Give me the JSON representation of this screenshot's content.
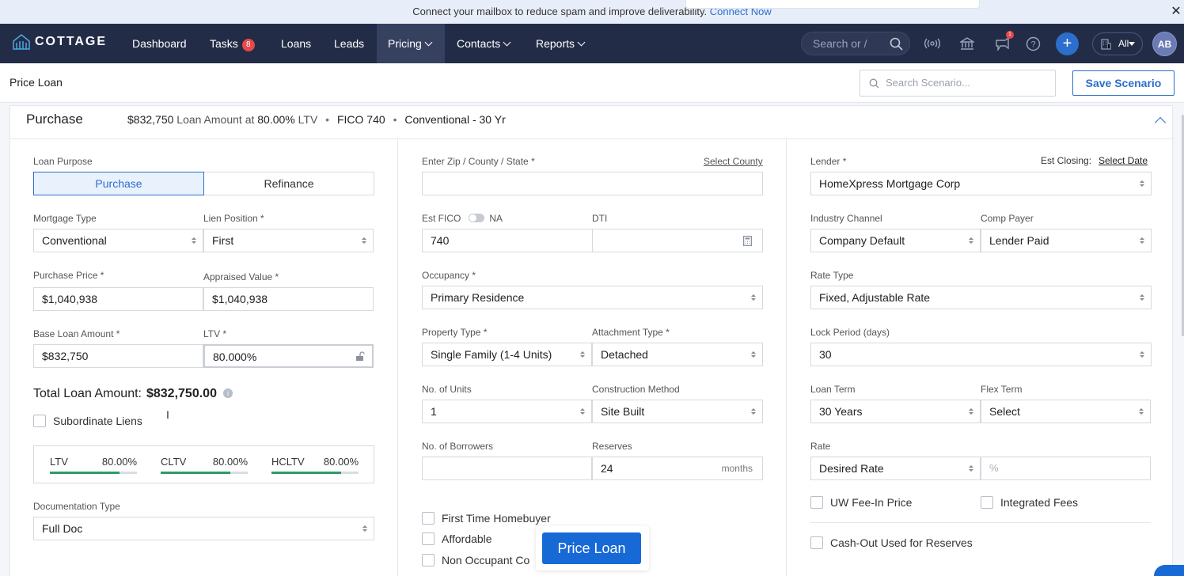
{
  "banner": {
    "text": "Connect your mailbox to reduce spam and improve deliverability.",
    "link": "Connect Now",
    "close": "✕"
  },
  "nav": {
    "logo": "COTTAGE",
    "items": [
      {
        "label": "Dashboard"
      },
      {
        "label": "Tasks",
        "badge": "8"
      },
      {
        "label": "Loans"
      },
      {
        "label": "Leads"
      },
      {
        "label": "Pricing"
      },
      {
        "label": "Contacts"
      },
      {
        "label": "Reports"
      }
    ],
    "search_placeholder": "Search or /",
    "notification_count": "1",
    "plus": "+",
    "all_label": "All",
    "avatar": "AB"
  },
  "subheader": {
    "title": "Price Loan",
    "search_placeholder": "Search Scenario...",
    "save_button": "Save Scenario"
  },
  "card": {
    "title": "Purchase",
    "summary": {
      "amount": "$832,750",
      "amount_label": "Loan Amount at",
      "ltv": "80.00%",
      "ltv_label": "LTV",
      "fico": "FICO 740",
      "product": "Conventional - 30 Yr"
    }
  },
  "left": {
    "loan_purpose_label": "Loan Purpose",
    "purpose_options": [
      "Purchase",
      "Refinance"
    ],
    "mortgage_type_label": "Mortgage Type",
    "mortgage_type": "Conventional",
    "lien_position_label": "Lien Position *",
    "lien_position": "First",
    "purchase_price_label": "Purchase Price *",
    "purchase_price": "$1,040,938",
    "appraised_value_label": "Appraised Value *",
    "appraised_value": "$1,040,938",
    "base_loan_label": "Base Loan Amount *",
    "base_loan": "$832,750",
    "ltv_label": "LTV *",
    "ltv": "80.000%",
    "total_label": "Total Loan Amount:",
    "total_value": "$832,750.00",
    "subordinate_liens": "Subordinate Liens",
    "ratios": [
      {
        "label": "LTV",
        "value": "80.00%"
      },
      {
        "label": "CLTV",
        "value": "80.00%"
      },
      {
        "label": "HCLTV",
        "value": "80.00%"
      }
    ],
    "documentation_label": "Documentation Type",
    "documentation": "Full Doc"
  },
  "middle": {
    "zip_label": "Enter Zip / County / State *",
    "select_county": "Select County",
    "zip_value": "",
    "est_fico_label": "Est FICO",
    "na_label": "NA",
    "est_fico": "740",
    "dti_label": "DTI",
    "occupancy_label": "Occupancy *",
    "occupancy": "Primary Residence",
    "property_type_label": "Property Type *",
    "property_type": "Single Family (1-4 Units)",
    "attachment_label": "Attachment Type *",
    "attachment": "Detached",
    "units_label": "No. of Units",
    "units": "1",
    "construction_label": "Construction Method",
    "construction": "Site Built",
    "borrowers_label": "No. of Borrowers",
    "reserves_label": "Reserves",
    "reserves": "24",
    "reserves_unit": "months",
    "checkboxes": [
      "First Time Homebuyer",
      "Affordable",
      "Non Occupant Co"
    ]
  },
  "right": {
    "lender_label": "Lender *",
    "est_closing_label": "Est Closing:",
    "select_date": "Select Date",
    "lender": "HomeXpress Mortgage Corp",
    "channel_label": "Industry Channel",
    "channel": "Company Default",
    "comp_payer_label": "Comp Payer",
    "comp_payer": "Lender Paid",
    "rate_type_label": "Rate Type",
    "rate_type": "Fixed, Adjustable Rate",
    "lock_label": "Lock Period (days)",
    "lock": "30",
    "loan_term_label": "Loan Term",
    "loan_term": "30 Years",
    "flex_term_label": "Flex Term",
    "flex_term": "Select",
    "rate_label": "Rate",
    "rate_mode": "Desired Rate",
    "rate_placeholder": "%",
    "uw_fee": "UW Fee-In Price",
    "integrated_fees": "Integrated Fees",
    "cash_out": "Cash-Out Used for Reserves"
  },
  "price_button": "Price Loan"
}
